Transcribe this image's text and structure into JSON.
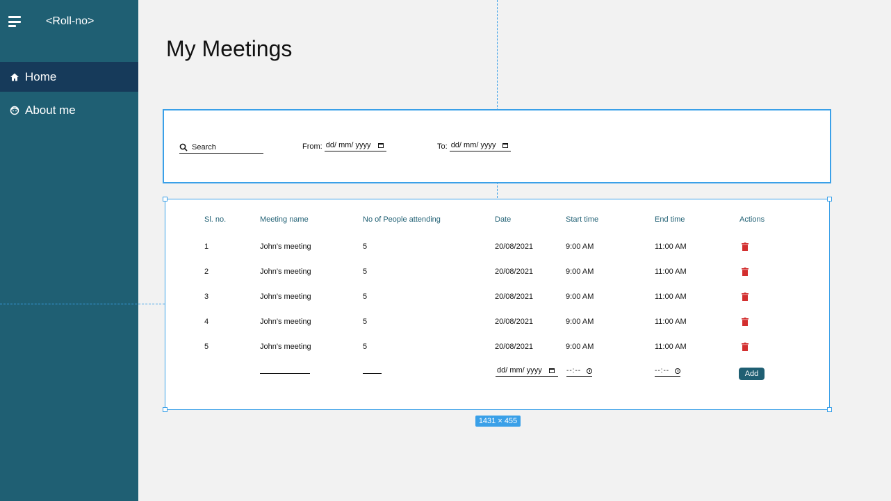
{
  "app": {
    "title": "<Roll-no>"
  },
  "sidebar": {
    "items": [
      {
        "label": "Home",
        "icon": "home-icon",
        "active": true
      },
      {
        "label": "About me",
        "icon": "face-icon",
        "active": false
      }
    ]
  },
  "page": {
    "title": "My Meetings"
  },
  "filters": {
    "search_label": "Search",
    "from_label": "From:",
    "from_value": "dd/ mm/ yyyy",
    "to_label": "To:",
    "to_value": "dd/ mm/ yyyy"
  },
  "table": {
    "headers": [
      "Sl. no.",
      "Meeting name",
      "No of People attending",
      "Date",
      "Start time",
      "End time",
      "Actions"
    ],
    "rows": [
      {
        "sl": "1",
        "name": "John's meeting",
        "people": "5",
        "date": "20/08/2021",
        "start": "9:00 AM",
        "end": "11:00 AM"
      },
      {
        "sl": "2",
        "name": "John's meeting",
        "people": "5",
        "date": "20/08/2021",
        "start": "9:00 AM",
        "end": "11:00 AM"
      },
      {
        "sl": "3",
        "name": "John's meeting",
        "people": "5",
        "date": "20/08/2021",
        "start": "9:00 AM",
        "end": "11:00 AM"
      },
      {
        "sl": "4",
        "name": "John's meeting",
        "people": "5",
        "date": "20/08/2021",
        "start": "9:00 AM",
        "end": "11:00 AM"
      },
      {
        "sl": "5",
        "name": "John's meeting",
        "people": "5",
        "date": "20/08/2021",
        "start": "9:00 AM",
        "end": "11:00 AM"
      }
    ],
    "new_row": {
      "date_placeholder": "dd/ mm/ yyyy",
      "start_placeholder": "--:--",
      "end_placeholder": "--:--",
      "add_label": "Add"
    }
  },
  "overlay": {
    "dimension_badge": "1431 × 455"
  },
  "colors": {
    "sidebar": "#1f5f73",
    "sidebar_active": "#163a5a",
    "accent": "#3aa0e8",
    "delete": "#d32f2f"
  }
}
